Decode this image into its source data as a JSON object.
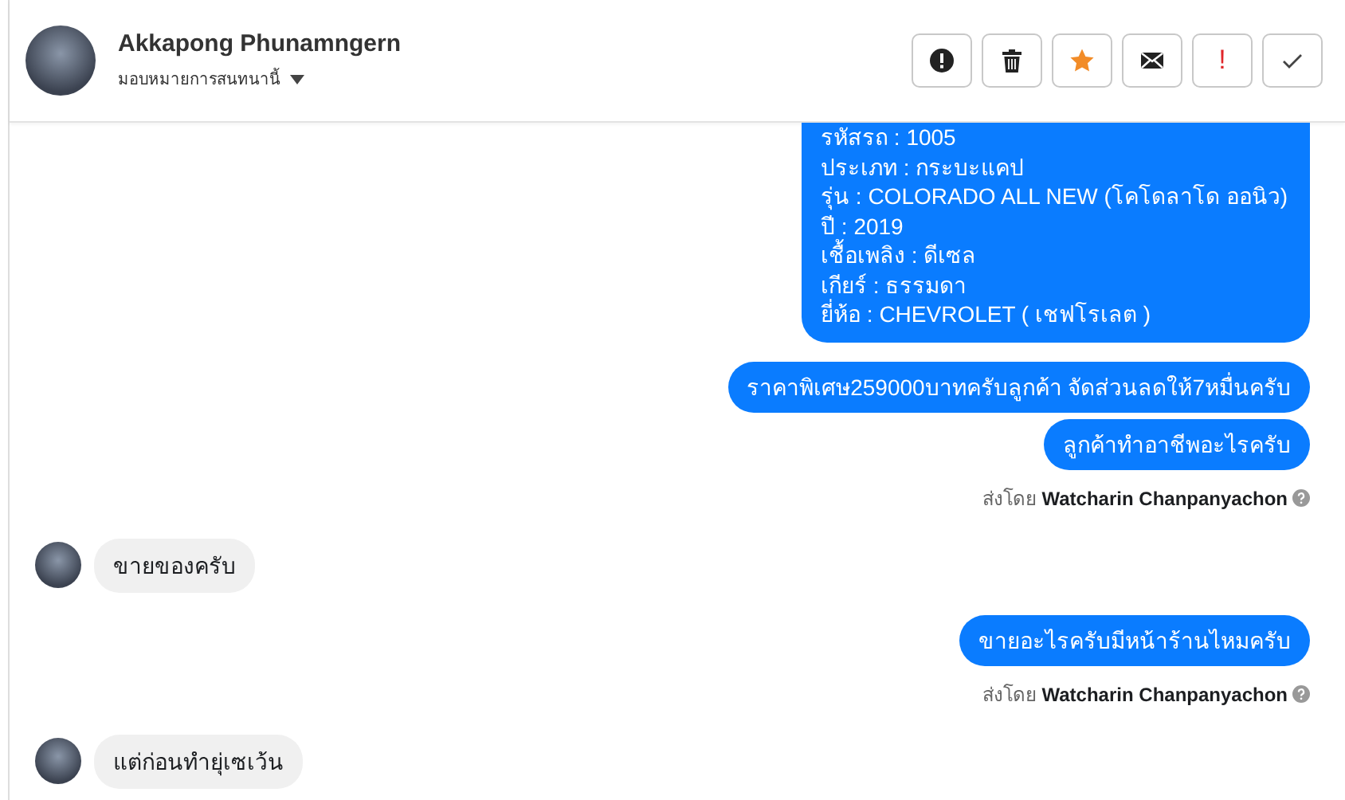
{
  "header": {
    "name": "Akkapong Phunamngern",
    "assign_label": "มอบหมายการสนทนานี้"
  },
  "actions": [
    {
      "kind": "report"
    },
    {
      "kind": "delete"
    },
    {
      "kind": "star"
    },
    {
      "kind": "mail"
    },
    {
      "kind": "text",
      "label": "!"
    },
    {
      "kind": "done"
    }
  ],
  "messages": [
    {
      "kind": "outgoing",
      "lines": [
        "รหัสรถ : 1005",
        "ประเภท : กระบะแคป",
        "รุ่น : COLORADO ALL NEW (โคโดลาโด ออนิว)",
        "ปี : 2019",
        "เชื้อเพลิง : ดีเซล",
        "เกียร์ : ธรรมดา",
        "ยี่ห้อ : CHEVROLET ( เชฟโรเลต )"
      ]
    },
    {
      "kind": "outgoing",
      "lines": [
        "ราคาพิเศษ259000บาทครับลูกค้า จัดส่วนลดให้7หมื่นครับ"
      ]
    },
    {
      "kind": "outgoing",
      "lines": [
        "ลูกค้าทำอาชีพอะไรครับ"
      ]
    },
    {
      "kind": "note",
      "prefix": "ส่งโดย",
      "name": "Watcharin Chanpanyachon"
    },
    {
      "kind": "incoming",
      "lines": [
        "ขายของครับ"
      ]
    },
    {
      "kind": "outgoing",
      "lines": [
        "ขายอะไรครับมีหน้าร้านไหมครับ"
      ]
    },
    {
      "kind": "note",
      "prefix": "ส่งโดย",
      "name": "Watcharin Chanpanyachon"
    },
    {
      "kind": "incoming",
      "lines": [
        "แต่ก่อนทำยุ่เซเว้น"
      ]
    }
  ]
}
